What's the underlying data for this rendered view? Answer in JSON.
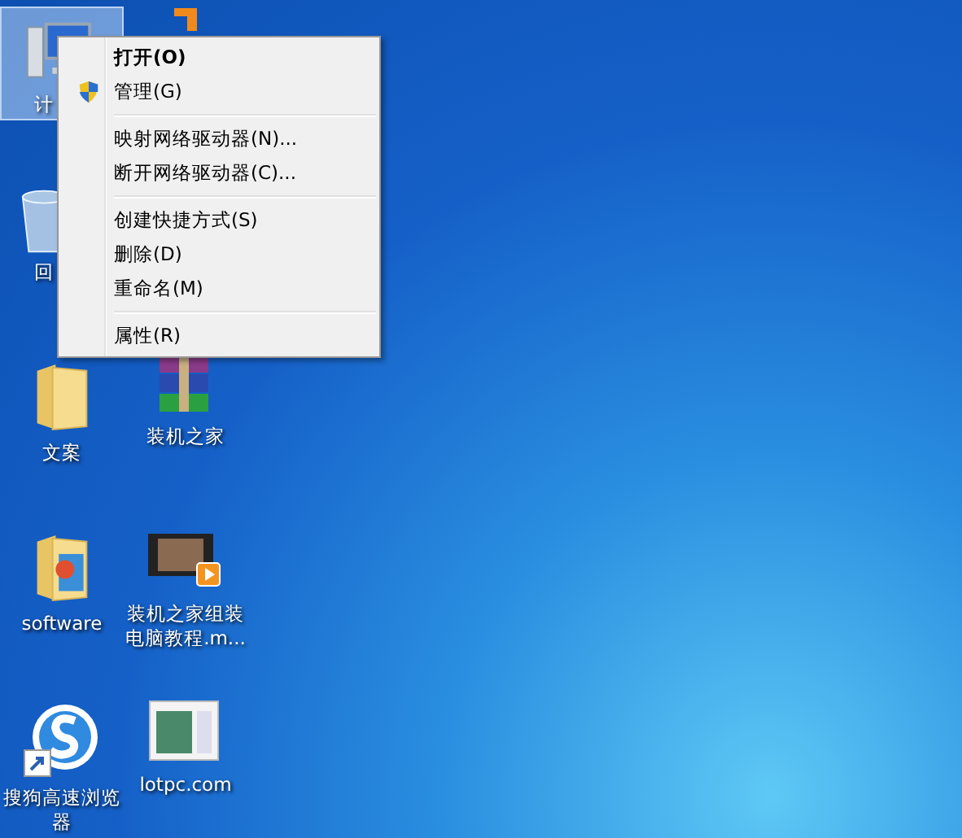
{
  "desktop": {
    "columns": [
      [
        {
          "kind": "computer",
          "label": "计",
          "selected": true,
          "covered": true
        },
        {
          "kind": "recycle-bin",
          "label": "回",
          "selected": false,
          "covered": true
        },
        {
          "kind": "folder",
          "label": "文案",
          "selected": false,
          "covered": false
        },
        {
          "kind": "folder-app",
          "label": "software",
          "selected": false,
          "covered": false
        },
        {
          "kind": "browser",
          "label": "搜狗高速浏览器",
          "selected": false,
          "covered": false
        }
      ],
      [
        {
          "kind": "app",
          "selected": false
        },
        {
          "kind": "archive",
          "label": "装机之家",
          "selected": false,
          "covered": false
        },
        {
          "kind": "video",
          "label": "装机之家组装电脑教程.m...",
          "selected": false,
          "covered": false
        },
        {
          "kind": "webpage",
          "label": "lotpc.com",
          "selected": false,
          "covered": false
        }
      ]
    ]
  },
  "context_menu": {
    "groups": [
      [
        {
          "kind": "plain",
          "label": "打开(O)",
          "default": true
        },
        {
          "kind": "shield",
          "label": "管理(G)",
          "default": false
        }
      ],
      [
        {
          "kind": "plain",
          "label": "映射网络驱动器(N)...",
          "default": false
        },
        {
          "kind": "plain",
          "label": "断开网络驱动器(C)...",
          "default": false
        }
      ],
      [
        {
          "kind": "plain",
          "label": "创建快捷方式(S)",
          "default": false
        },
        {
          "kind": "plain",
          "label": "删除(D)",
          "default": false
        },
        {
          "kind": "plain",
          "label": "重命名(M)",
          "default": false
        }
      ],
      [
        {
          "kind": "plain",
          "label": "属性(R)",
          "default": false
        }
      ]
    ]
  }
}
